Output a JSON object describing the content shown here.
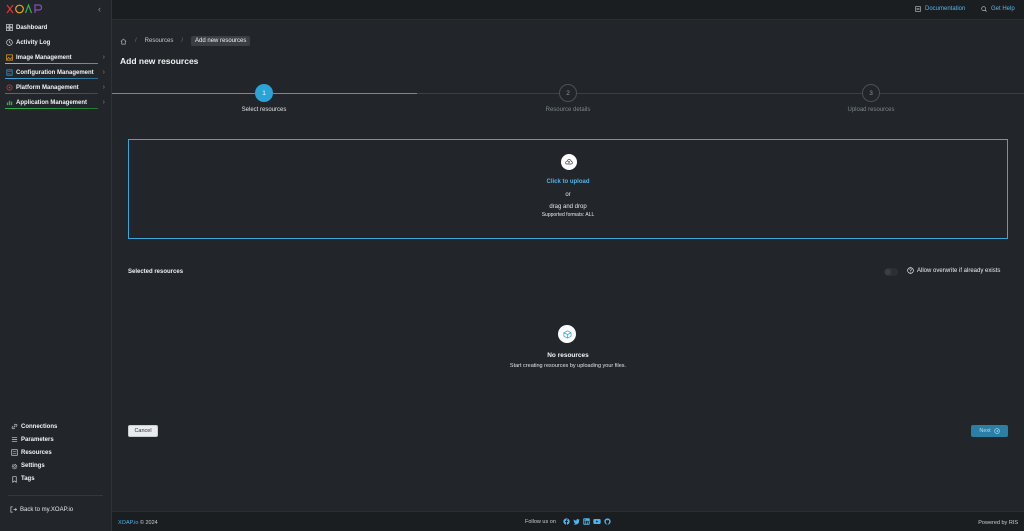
{
  "app": {
    "logo_text": "XOAP",
    "brand_colors": [
      "#e2342d",
      "#f2a31b",
      "#2fb34a",
      "#3aa6dd",
      "#8d4bbd"
    ]
  },
  "sidebar": {
    "items": [
      {
        "label": "Dashboard",
        "icon": "grid-icon",
        "has_chevron": false
      },
      {
        "label": "Activity Log",
        "icon": "clock-icon",
        "has_chevron": false
      },
      {
        "label": "Image Management",
        "icon": "image-icon",
        "has_chevron": true,
        "color": "#f2a31b"
      },
      {
        "label": "Configuration Management",
        "icon": "config-icon",
        "has_chevron": true,
        "color": "#3aa6dd"
      },
      {
        "label": "Platform Management",
        "icon": "platform-icon",
        "has_chevron": true,
        "color": "#e2342d"
      },
      {
        "label": "Application Management",
        "icon": "app-icon",
        "has_chevron": true,
        "color": "#2fb34a"
      }
    ],
    "bottom_items": [
      {
        "label": "Connections",
        "icon": "link-icon"
      },
      {
        "label": "Parameters",
        "icon": "list-icon"
      },
      {
        "label": "Resources",
        "icon": "resources-icon"
      },
      {
        "label": "Settings",
        "icon": "gear-icon"
      },
      {
        "label": "Tags",
        "icon": "tag-icon"
      }
    ],
    "back_label": "Back to my.XOAP.io"
  },
  "topbar": {
    "documentation": "Documentation",
    "get_help": "Get Help"
  },
  "breadcrumb": {
    "items": [
      "Resources",
      "Add new resources"
    ]
  },
  "page": {
    "title": "Add new resources"
  },
  "stepper": {
    "active_color": "#2aa3d8",
    "steps": [
      {
        "number": "1",
        "label": "Select resources",
        "active": true
      },
      {
        "number": "2",
        "label": "Resource details",
        "active": false
      },
      {
        "number": "3",
        "label": "Upload resources",
        "active": false
      }
    ]
  },
  "upload": {
    "click_label": "Click to upload",
    "or_label": "or",
    "drag_label": "drag and drop",
    "formats_label": "Supported formats: ALL"
  },
  "selected": {
    "title": "Selected resources",
    "overwrite_label": "Allow overwrite if already exists",
    "overwrite_enabled": false
  },
  "empty": {
    "title": "No resources",
    "subtitle": "Start creating resources by uploading your files."
  },
  "actions": {
    "cancel": "Cancel",
    "next": "Next"
  },
  "footer": {
    "brand": "XOAP.io",
    "copyright": "© 2024",
    "follow": "Follow us on",
    "socials": [
      "facebook-icon",
      "twitter-icon",
      "linkedin-icon",
      "youtube-icon",
      "github-icon"
    ],
    "powered": "Powered by RIS"
  }
}
